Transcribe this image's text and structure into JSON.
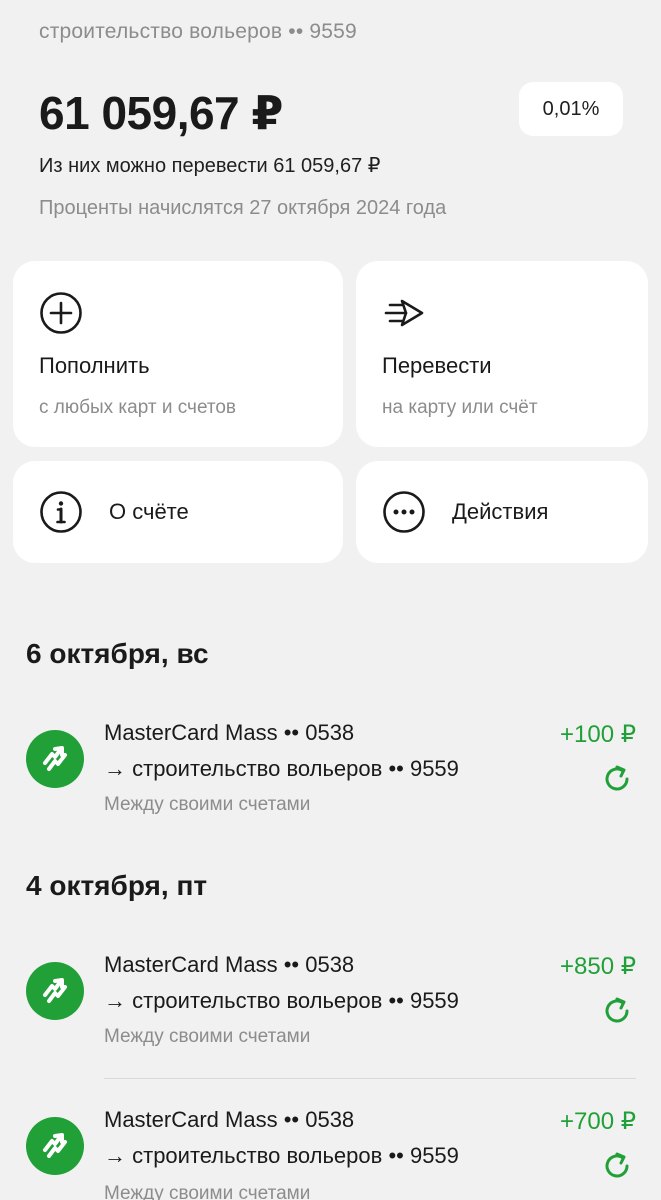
{
  "account": {
    "name": "строительство вольеров •• 9559",
    "balance": "61 059,67 ₽",
    "rate": "0,01%",
    "transferable": "Из них можно перевести 61 059,67 ₽",
    "interest_note": "Проценты начислятся 27 октября 2024 года"
  },
  "actions": {
    "top_up": {
      "title": "Пополнить",
      "subtitle": "с любых карт и счетов",
      "icon": "plus-circle-icon"
    },
    "transfer": {
      "title": "Перевести",
      "subtitle": "на карту или счёт",
      "icon": "send-arrow-icon"
    },
    "about": {
      "label": "О счёте",
      "icon": "info-icon"
    },
    "more": {
      "label": "Действия",
      "icon": "more-dots-icon"
    }
  },
  "history": {
    "groups": [
      {
        "date": "6 октября, вс",
        "items": [
          {
            "from": "MasterCard Mass •• 0538",
            "to": "→ строительство вольеров •• 9559",
            "category": "Между своими счетами",
            "amount": "+100 ₽"
          }
        ]
      },
      {
        "date": "4 октября, пт",
        "items": [
          {
            "from": "MasterCard Mass •• 0538",
            "to": "→ строительство вольеров •• 9559",
            "category": "Между своими счетами",
            "amount": "+850 ₽"
          },
          {
            "from": "MasterCard Mass •• 0538",
            "to": "→ строительство вольеров •• 9559",
            "category": "Между своими счетами",
            "amount": "+700 ₽"
          }
        ]
      }
    ]
  },
  "colors": {
    "accent": "#21a038",
    "background": "#f1f1f1",
    "muted": "#8c8c8c"
  }
}
